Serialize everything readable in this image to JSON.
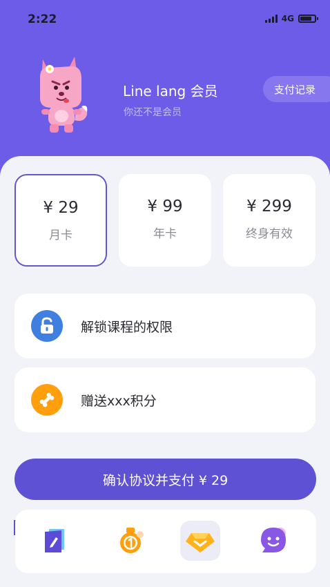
{
  "status_bar": {
    "time": "2:22",
    "network": "4G"
  },
  "profile": {
    "username": "Line lang 会员",
    "membership_status": "你还不是会员",
    "records_button": "支付记录"
  },
  "plans": [
    {
      "price": "¥ 29",
      "name": "月卡",
      "selected": true
    },
    {
      "price": "¥ 99",
      "name": "年卡",
      "selected": false
    },
    {
      "price": "¥ 299",
      "name": "终身有效",
      "selected": false
    }
  ],
  "benefits": [
    {
      "icon": "unlock-icon",
      "text": "解锁课程的权限",
      "color": "#3f7fe0"
    },
    {
      "icon": "bone-icon",
      "text": "赠送xxx积分",
      "color": "#ff9f0d"
    }
  ],
  "confirm_button": "确认协议并支付 ¥ 29",
  "tabs": [
    {
      "icon": "book-edit-icon",
      "active": false
    },
    {
      "icon": "medal-icon",
      "active": false
    },
    {
      "icon": "vip-diamond-icon",
      "active": true
    },
    {
      "icon": "chat-icon",
      "active": false
    }
  ],
  "colors": {
    "header": "#6c5ce7",
    "primary": "#5e51d3",
    "background": "#f2f3f8"
  }
}
